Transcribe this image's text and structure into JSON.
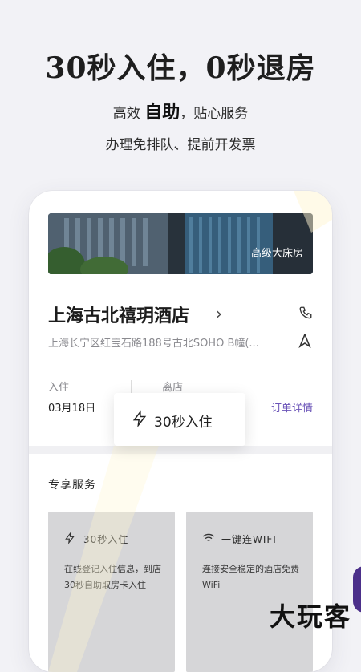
{
  "promo": {
    "headline": "30秒入住，0秒退房",
    "line1_prefix": "高效 ",
    "line1_bold": "自助",
    "line1_suffix": "，贴心服务",
    "line2": "办理免排队、提前开发票"
  },
  "hotel_card": {
    "room_type": "高级大床房",
    "hotel_name": "上海古北禧玥酒店",
    "address": "上海长宁区红宝石路188号古北SOHO B幢(...",
    "checkin_label": "入住",
    "checkout_label": "离店",
    "checkin_date": "03月18日",
    "order_detail_link": "订单详情"
  },
  "popup": {
    "text": "30秒入住"
  },
  "services": {
    "section_title": "专享服务",
    "items": [
      {
        "title": "30秒入住",
        "desc": "在线登记入住信息，到店30秒自助取房卡入住",
        "icon": "bolt-icon"
      },
      {
        "title": "一键连WIFI",
        "desc": "连接安全稳定的酒店免费WiFi",
        "icon": "wifi-icon"
      }
    ]
  },
  "watermark": "大玩客",
  "colors": {
    "background": "#f2f2f6",
    "accent_link": "#6b54b8",
    "service_card": "#d6d6d8",
    "purple_tab": "#4b2f8a"
  }
}
